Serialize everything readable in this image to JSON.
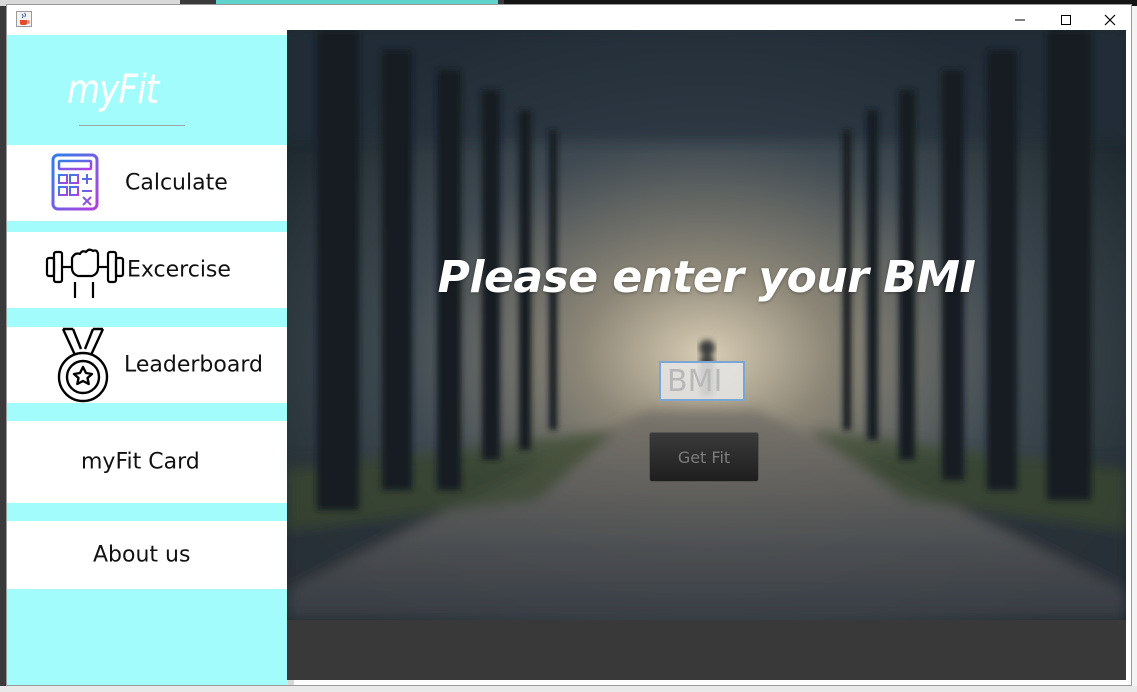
{
  "window": {
    "app_icon": "java-cup-icon",
    "controls": [
      "minimize-icon",
      "maximize-icon",
      "close-icon"
    ]
  },
  "sidebar": {
    "logo": "myFit",
    "items": [
      {
        "label": "Calculate",
        "icon": "calculator-icon"
      },
      {
        "label": "Excercise",
        "icon": "dumbbell-fist-icon"
      },
      {
        "label": "Leaderboard",
        "icon": "medal-icon"
      },
      {
        "label": "myFit Card"
      },
      {
        "label": "About us"
      }
    ]
  },
  "main": {
    "headline": "Please enter your BMI",
    "bmi_input": {
      "placeholder": "BMI",
      "value": ""
    },
    "submit_label": "Get Fit",
    "background": "blurred-forest-path-photo"
  },
  "colors": {
    "sidebar": "#a3fcfc",
    "button_dark": "#2a2a2a",
    "input_border": "#7aa6d6"
  }
}
